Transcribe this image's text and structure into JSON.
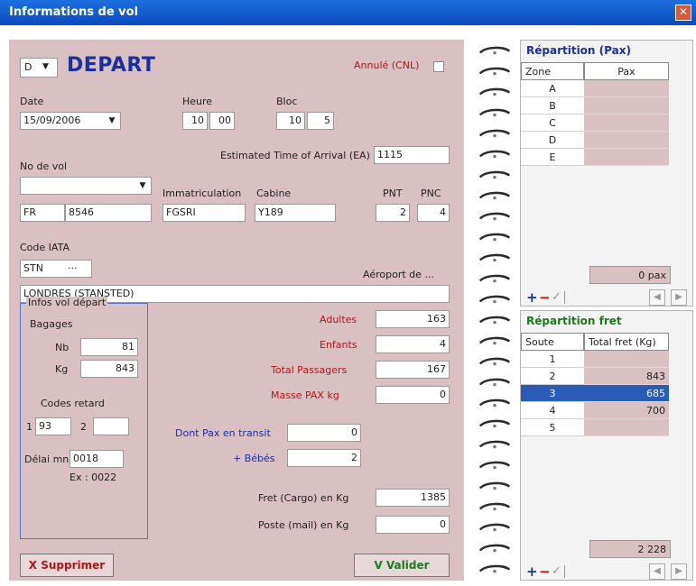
{
  "window": {
    "title": "Informations de vol",
    "close": "✕"
  },
  "header": {
    "direction_select": "D",
    "direction_arrow": "▼",
    "title": "DEPART",
    "cancelled_label": "Annulé (CNL)"
  },
  "date": {
    "label": "Date",
    "value": "15/09/2006",
    "arrow": "▼"
  },
  "heure": {
    "label": "Heure",
    "hh": "10",
    "mm": "00"
  },
  "bloc": {
    "label": "Bloc",
    "hh": "10",
    "mm": "5"
  },
  "eta": {
    "label": "Estimated Time of Arrival (EA)",
    "value": "1115"
  },
  "flight": {
    "label": "No de vol",
    "select_value": "",
    "arrow": "▼",
    "prefix": "FR",
    "number": "8546",
    "immat_label": "Immatriculation",
    "immat": "FGSRI",
    "cabine_label": "Cabine",
    "cabine": "Y189",
    "pnt_label": "PNT",
    "pnt": "2",
    "pnc_label": "PNC",
    "pnc": "4"
  },
  "iata": {
    "label": "Code IATA",
    "code": "STN",
    "more": "···",
    "airport_label": "Aéroport de ...",
    "airport": "LONDRES (STANSTED)"
  },
  "infos": {
    "group_title": "Infos vol départ",
    "bagages": "Bagages",
    "nb_label": "Nb",
    "nb": "81",
    "kg_label": "Kg",
    "kg": "843",
    "codes_retard": "Codes retard",
    "r1_label": "1",
    "r1": "93",
    "r2_label": "2",
    "r2": "",
    "delai_label": "Délai mn",
    "delai": "0018",
    "example": "Ex : 0022"
  },
  "pax": {
    "adultes_label": "Adultes",
    "adultes": "163",
    "enfants_label": "Enfants",
    "enfants": "4",
    "total_label": "Total Passagers",
    "total": "167",
    "masse_label": "Masse PAX  kg",
    "masse": "0",
    "transit_label": "Dont Pax en transit",
    "transit": "0",
    "bebes_label": "+ Bébés",
    "bebes": "2"
  },
  "fret": {
    "cargo_label": "Fret (Cargo) en Kg",
    "cargo": "1385",
    "mail_label": "Poste (mail) en Kg",
    "mail": "0"
  },
  "buttons": {
    "delete": "X Supprimer",
    "validate": "V Valider"
  },
  "repartition_pax": {
    "title": "Répartition (Pax)",
    "col1": "Zone",
    "col2": "Pax",
    "rows": [
      {
        "a": "A",
        "b": ""
      },
      {
        "a": "B",
        "b": ""
      },
      {
        "a": "C",
        "b": ""
      },
      {
        "a": "D",
        "b": ""
      },
      {
        "a": "E",
        "b": ""
      }
    ],
    "total": "0 pax"
  },
  "repartition_fret": {
    "title": "Répartition fret",
    "col1": "Soute",
    "col2": "Total fret (Kg)",
    "rows": [
      {
        "a": "1",
        "b": ""
      },
      {
        "a": "2",
        "b": "843"
      },
      {
        "a": "3",
        "b": "685"
      },
      {
        "a": "4",
        "b": "700"
      },
      {
        "a": "5",
        "b": ""
      }
    ],
    "total": "2 228"
  },
  "nav": {
    "plus": "+",
    "minus": "−",
    "check": "✓",
    "prev": "◀",
    "next": "▶"
  },
  "colors": {
    "title_blue": "#1c2f9e",
    "label_red": "#b01818",
    "panel_pink": "#d8c0c3",
    "selected_row": "#2a5bb7",
    "fret_title_green": "#1c7a1c"
  }
}
